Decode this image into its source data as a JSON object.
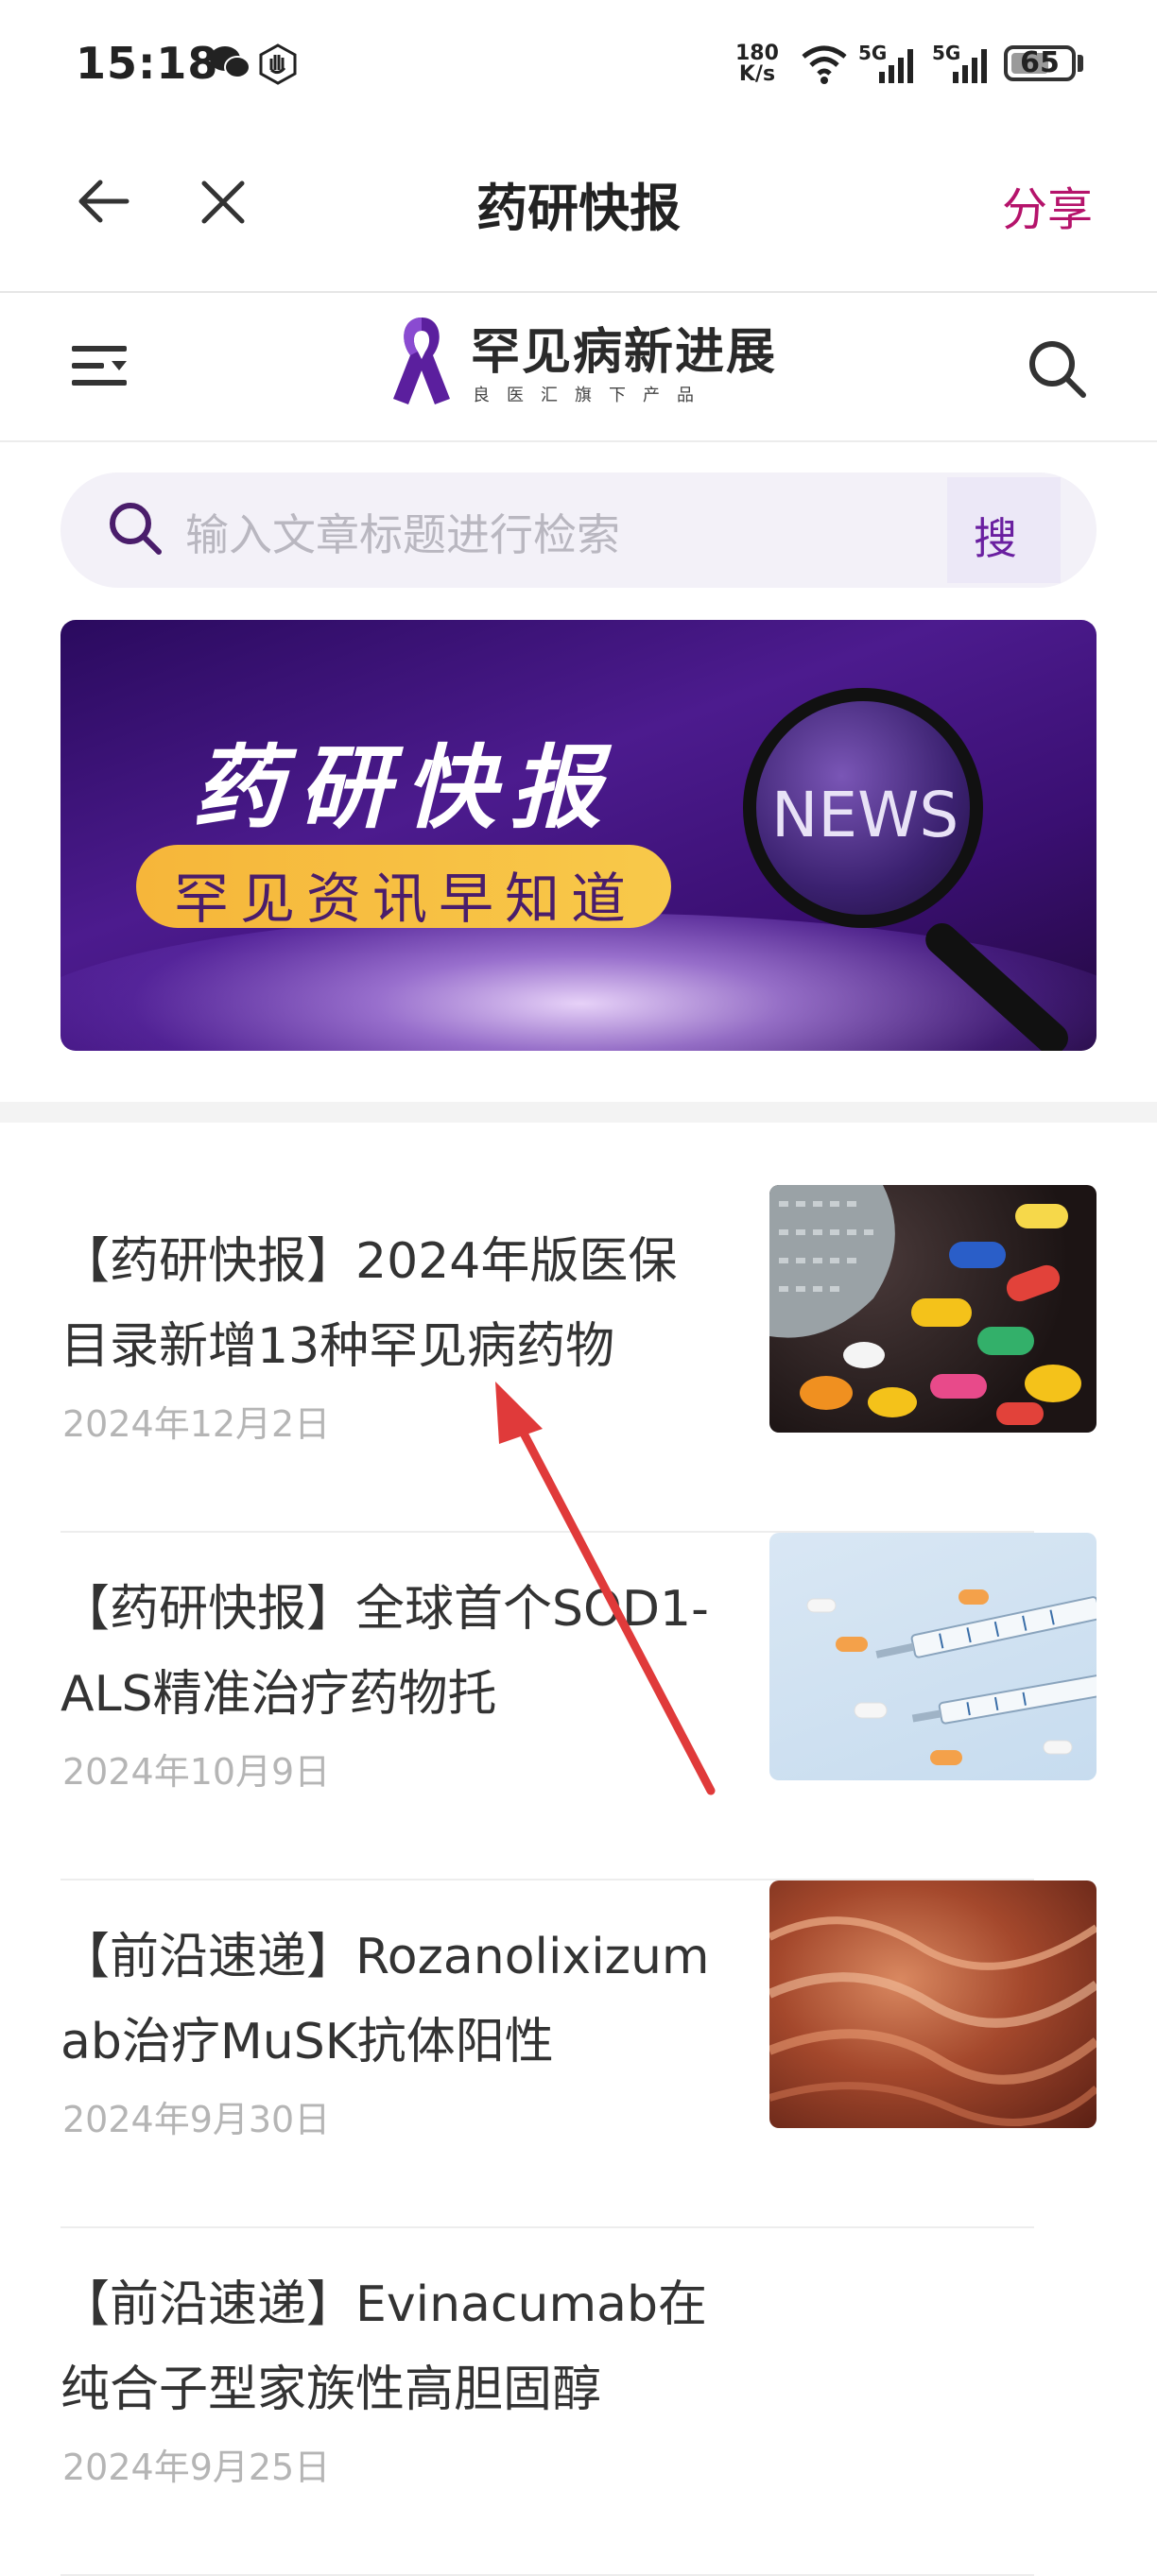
{
  "status_bar": {
    "time": "15:18",
    "network_speed_top": "180",
    "network_speed_bottom": "K/s",
    "signal_1": "5G",
    "signal_2": "5G",
    "battery": "65",
    "battery_level": 0.65
  },
  "nav": {
    "title": "药研快报",
    "share_label": "分享"
  },
  "brand": {
    "name": "罕见病新进展",
    "subtitle": "良医汇旗下产品"
  },
  "search": {
    "placeholder": "输入文章标题进行检索",
    "button_label": "搜"
  },
  "banner": {
    "title": "药研快报",
    "slogan": "罕见资讯早知道",
    "lens_text": "NEWS"
  },
  "articles": [
    {
      "title": "【药研快报】2024年版医保目录新增13种罕见病药物",
      "date": "2024年12月2日"
    },
    {
      "title": "【药研快报】全球首个SOD1-ALS精准治疗药物托",
      "date": "2024年10月9日"
    },
    {
      "title": "【前沿速递】Rozanolixizumab治疗MuSK抗体阳性",
      "date": "2024年9月30日"
    },
    {
      "title": "【前沿速递】Evinacumab在纯合子型家族性高胆固醇",
      "date": "2024年9月25日"
    }
  ],
  "colors": {
    "accent": "#b5136b",
    "brand_purple": "#6a1fa0",
    "annotation_arrow": "#e03a3a"
  }
}
